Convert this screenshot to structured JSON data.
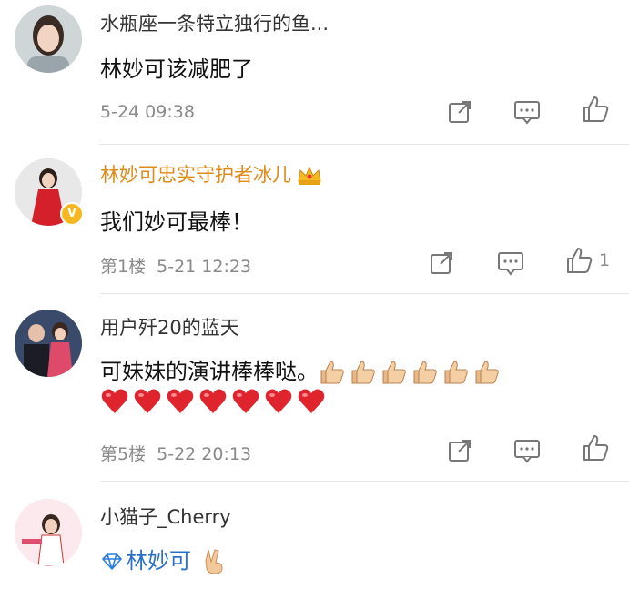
{
  "comments": [
    {
      "username": "水瓶座一条特立独行的鱼...",
      "text": "林妙可该减肥了",
      "floor": "",
      "time": "5-24 09:38",
      "likes": ""
    },
    {
      "username": "林妙可忠实守护者冰儿",
      "text": "我们妙可最棒！",
      "floor": "第1楼",
      "time": "5-21 12:23",
      "likes": "1"
    },
    {
      "username": "用户歼20的蓝天",
      "text": "可妹妹的演讲棒棒哒。",
      "floor": "第5楼",
      "time": "5-22 20:13",
      "likes": ""
    },
    {
      "username": "小猫子_Cherry",
      "text": "林妙可",
      "floor": "",
      "time": "",
      "likes": ""
    }
  ],
  "icons": {
    "share": "share-icon",
    "comment": "comment-icon",
    "like": "thumbs-up-icon",
    "crown": "crown-badge-icon",
    "verified": "verified-badge-icon",
    "diamond": "diamond-icon"
  },
  "colors": {
    "gold_username": "#e08a17",
    "meta_gray": "#8a8a8a",
    "heart_red": "#e0242e"
  },
  "emoji": {
    "thumbs_count": 6,
    "hearts_count": 7
  }
}
